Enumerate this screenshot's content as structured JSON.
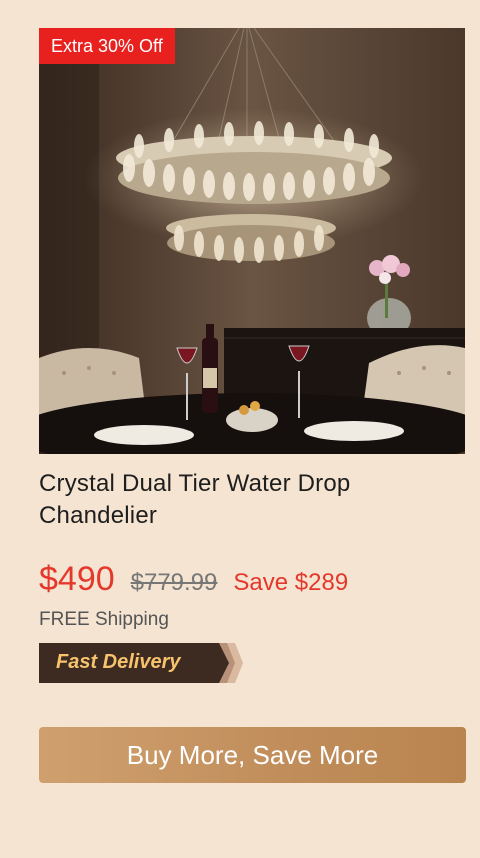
{
  "product": {
    "badge": "Extra 30% Off",
    "title": "Crystal Dual Tier Water Drop\n Chandelier",
    "price": "$490",
    "original_price": "$779.99",
    "savings": "Save $289",
    "shipping": "FREE Shipping",
    "delivery_tag": "Fast Delivery"
  },
  "cta": {
    "label": "Buy More, Save More"
  },
  "colors": {
    "background": "#f5e4d1",
    "accent_red": "#e5382c",
    "button": "#c08d5a",
    "badge": "#e8201e"
  }
}
